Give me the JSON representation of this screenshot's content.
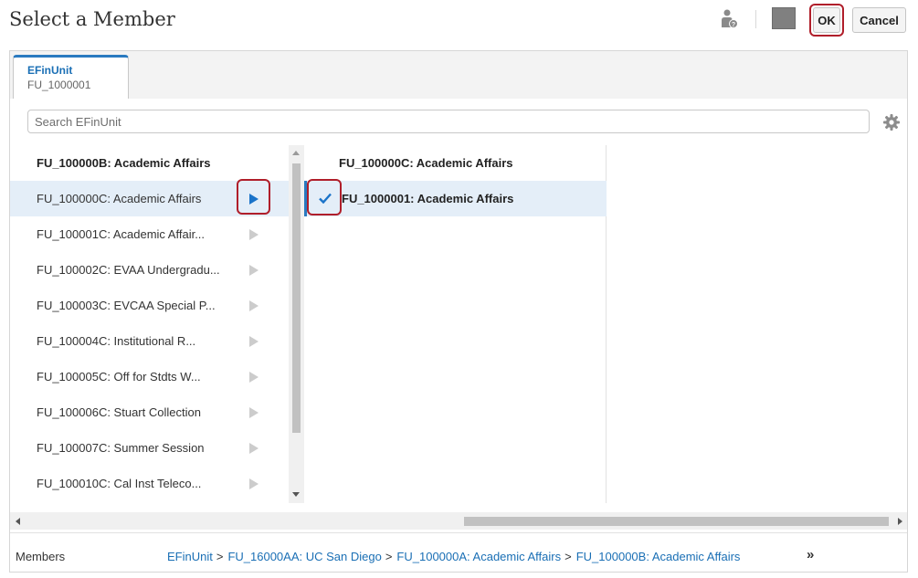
{
  "dialog": {
    "title": "Select a Member"
  },
  "header": {
    "ok_label": "OK",
    "cancel_label": "Cancel",
    "icons": [
      "user-help-icon",
      "color-square-icon"
    ]
  },
  "tab": {
    "title": "EFinUnit",
    "subtitle": "FU_1000001"
  },
  "search": {
    "placeholder": "Search EFinUnit",
    "value": ""
  },
  "column1": {
    "items": [
      {
        "label": "FU_100000B: Academic Affairs",
        "bold": true,
        "selected": false,
        "has_children": false
      },
      {
        "label": "FU_100000C: Academic Affairs",
        "bold": false,
        "selected": true,
        "has_children": true
      },
      {
        "label": "FU_100001C: Academic Affair...",
        "bold": false,
        "selected": false,
        "has_children": true
      },
      {
        "label": "FU_100002C: EVAA Undergradu...",
        "bold": false,
        "selected": false,
        "has_children": true
      },
      {
        "label": "FU_100003C: EVCAA Special P...",
        "bold": false,
        "selected": false,
        "has_children": true
      },
      {
        "label": "FU_100004C: Institutional R...",
        "bold": false,
        "selected": false,
        "has_children": true
      },
      {
        "label": "FU_100005C: Off for Stdts W...",
        "bold": false,
        "selected": false,
        "has_children": true
      },
      {
        "label": "FU_100006C: Stuart Collection",
        "bold": false,
        "selected": false,
        "has_children": true
      },
      {
        "label": "FU_100007C: Summer Session",
        "bold": false,
        "selected": false,
        "has_children": true
      },
      {
        "label": "FU_100010C: Cal Inst Teleco...",
        "bold": false,
        "selected": false,
        "has_children": true
      }
    ]
  },
  "column2": {
    "items": [
      {
        "label": "FU_100000C: Academic Affairs",
        "checked": false
      },
      {
        "label": "FU_1000001: Academic Affairs",
        "checked": true
      }
    ]
  },
  "footer": {
    "label": "Members",
    "breadcrumbs": [
      "EFinUnit",
      "FU_16000AA: UC San Diego",
      "FU_100000A: Academic Affairs",
      "FU_100000B: Academic Affairs"
    ],
    "separator": ">",
    "more": "»"
  },
  "colors": {
    "accent": "#1a6fb5",
    "highlight": "#b01e2a",
    "selection": "#e4eef8",
    "chevron_active": "#1a73c9",
    "chevron_inactive": "#c8c8c8"
  }
}
